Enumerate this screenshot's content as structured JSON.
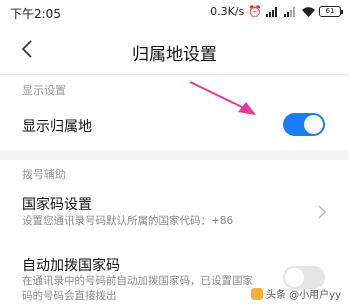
{
  "status_bar": {
    "time": "下午2:05",
    "net_speed": "0.3K/s",
    "battery": "61"
  },
  "header": {
    "title": "归属地设置"
  },
  "sections": {
    "display": {
      "label": "显示设置",
      "show_location": {
        "title": "显示归属地",
        "enabled": true
      }
    },
    "dial_assist": {
      "label": "拨号辅助",
      "country_code": {
        "title": "国家码设置",
        "subtitle": "设置您通讯录号码默认所属的国家代码：+86"
      },
      "auto_add_code": {
        "title": "自动加拨国家码",
        "subtitle_line1": "在通讯录中的号码前自动加拨国家码，已设置国家",
        "subtitle_line2": "码的号码会直接拨出",
        "enabled": false
      }
    }
  },
  "watermark": "头条 @小用户yy",
  "colors": {
    "accent": "#1a7ef5",
    "annotation": "#e8369a"
  }
}
